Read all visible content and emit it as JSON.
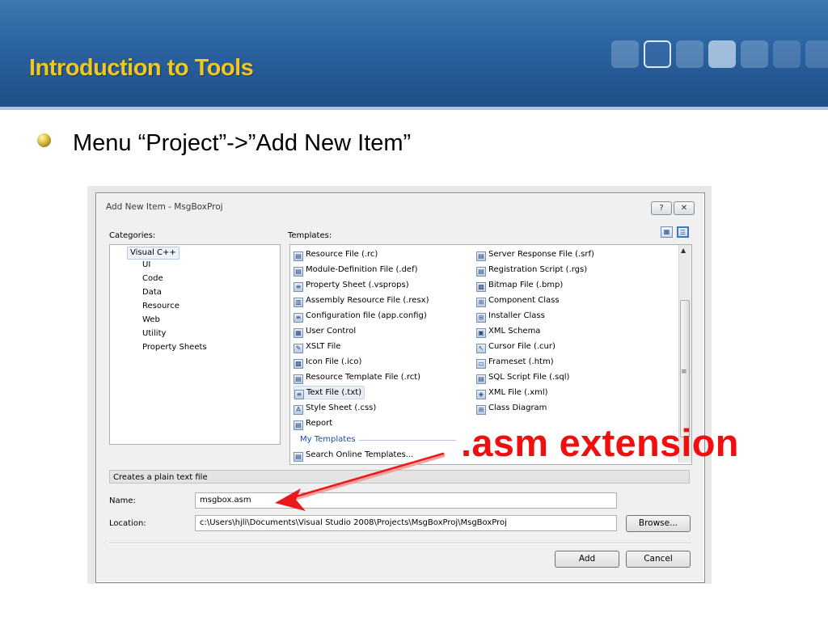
{
  "slide": {
    "title": "Introduction to Tools",
    "bullet": "Menu “Project”->”Add New Item”",
    "annotation": ".asm extension",
    "colors": {
      "header": "#2b62a0",
      "title": "#f3c623",
      "annotation": "#ef0f0f"
    }
  },
  "dialog": {
    "title": "Add New Item - MsgBoxProj",
    "help_icon": "?",
    "close_icon": "✕",
    "categories_label": "Categories:",
    "templates_label": "Templates:",
    "categories": {
      "selected": "Visual C++",
      "children": [
        "UI",
        "Code",
        "Data",
        "Resource",
        "Web",
        "Utility",
        "Property Sheets"
      ]
    },
    "templates_left": [
      {
        "label": "Resource File (.rc)",
        "icon": "resource-icon"
      },
      {
        "label": "Module-Definition File (.def)",
        "icon": "module-icon"
      },
      {
        "label": "Property Sheet (.vsprops)",
        "icon": "property-sheet-icon"
      },
      {
        "label": "Assembly Resource File (.resx)",
        "icon": "assembly-icon"
      },
      {
        "label": "Configuration file (app.config)",
        "icon": "config-icon"
      },
      {
        "label": "User Control",
        "icon": "user-control-icon"
      },
      {
        "label": "XSLT File",
        "icon": "xslt-icon"
      },
      {
        "label": "Icon File (.ico)",
        "icon": "icon-file-icon"
      },
      {
        "label": "Resource Template File (.rct)",
        "icon": "resource-template-icon"
      },
      {
        "label": "Text File (.txt)",
        "icon": "text-file-icon"
      },
      {
        "label": "Style Sheet (.css)",
        "icon": "style-sheet-icon"
      },
      {
        "label": "Report",
        "icon": "report-icon"
      }
    ],
    "templates_right": [
      {
        "label": "Server Response File (.srf)",
        "icon": "server-icon"
      },
      {
        "label": "Registration Script (.rgs)",
        "icon": "script-icon"
      },
      {
        "label": "Bitmap File (.bmp)",
        "icon": "bitmap-icon"
      },
      {
        "label": "Component Class",
        "icon": "component-icon"
      },
      {
        "label": "Installer Class",
        "icon": "installer-icon"
      },
      {
        "label": "XML Schema",
        "icon": "xml-schema-icon"
      },
      {
        "label": "Cursor File (.cur)",
        "icon": "cursor-icon"
      },
      {
        "label": "Frameset (.htm)",
        "icon": "frameset-icon"
      },
      {
        "label": "SQL Script File (.sql)",
        "icon": "sql-icon"
      },
      {
        "label": "XML File (.xml)",
        "icon": "xml-file-icon"
      },
      {
        "label": "Class Diagram",
        "icon": "class-diagram-icon"
      }
    ],
    "my_templates_label": "My Templates",
    "search_online": "Search Online Templates...",
    "description": "Creates a plain text file",
    "name_label": "Name:",
    "name_value": "msgbox.asm",
    "location_label": "Location:",
    "location_value": "c:\\Users\\hjli\\Documents\\Visual Studio 2008\\Projects\\MsgBoxProj\\MsgBoxProj",
    "browse_label": "Browse...",
    "add_label": "Add",
    "cancel_label": "Cancel"
  }
}
